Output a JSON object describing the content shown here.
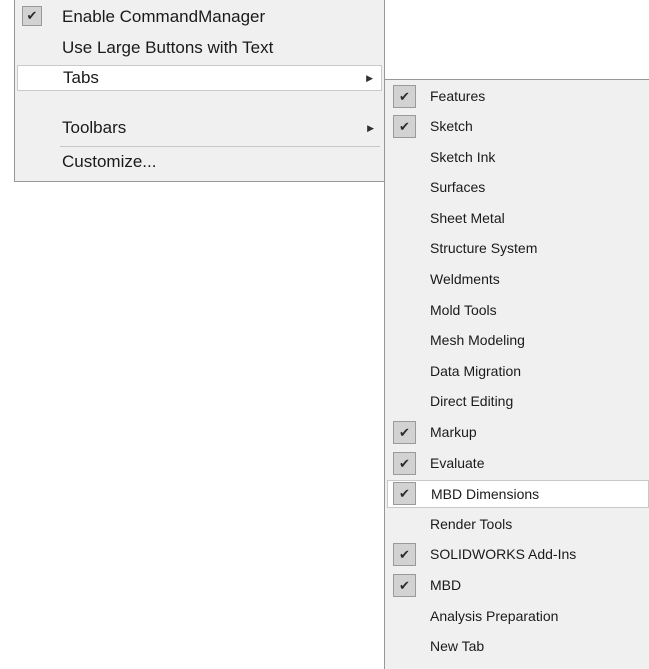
{
  "main_menu": {
    "items": [
      {
        "label": "Enable CommandManager",
        "checked": true,
        "submenu": false,
        "icon": "check-icon"
      },
      {
        "label": "Use Large Buttons with Text",
        "checked": false,
        "submenu": false
      },
      {
        "label": "Tabs",
        "checked": false,
        "submenu": true,
        "highlighted": true,
        "arrow_icon": "chevron-right-icon"
      },
      {
        "label": "Toolbars",
        "checked": false,
        "submenu": true,
        "arrow_icon": "chevron-right-icon"
      },
      {
        "label": "Customize...",
        "checked": false,
        "submenu": false
      }
    ]
  },
  "tabs_submenu": {
    "items": [
      {
        "label": "Features",
        "checked": true
      },
      {
        "label": "Sketch",
        "checked": true
      },
      {
        "label": "Sketch Ink",
        "checked": false
      },
      {
        "label": "Surfaces",
        "checked": false
      },
      {
        "label": "Sheet Metal",
        "checked": false
      },
      {
        "label": "Structure System",
        "checked": false
      },
      {
        "label": "Weldments",
        "checked": false
      },
      {
        "label": "Mold Tools",
        "checked": false
      },
      {
        "label": "Mesh Modeling",
        "checked": false
      },
      {
        "label": "Data Migration",
        "checked": false
      },
      {
        "label": "Direct Editing",
        "checked": false
      },
      {
        "label": "Markup",
        "checked": true
      },
      {
        "label": "Evaluate",
        "checked": true
      },
      {
        "label": "MBD Dimensions",
        "checked": true,
        "highlighted": true
      },
      {
        "label": "Render Tools",
        "checked": false
      },
      {
        "label": "SOLIDWORKS Add-Ins",
        "checked": true
      },
      {
        "label": "MBD",
        "checked": true
      },
      {
        "label": "Analysis Preparation",
        "checked": false
      },
      {
        "label": "New Tab",
        "checked": false
      }
    ]
  },
  "glyphs": {
    "check": "✔",
    "arrow": "▶"
  },
  "colors": {
    "menu_background": "#f0f0f0",
    "menu_border": "#979797",
    "highlight_background": "#ffffff",
    "check_box_background": "#d2d2d2"
  }
}
